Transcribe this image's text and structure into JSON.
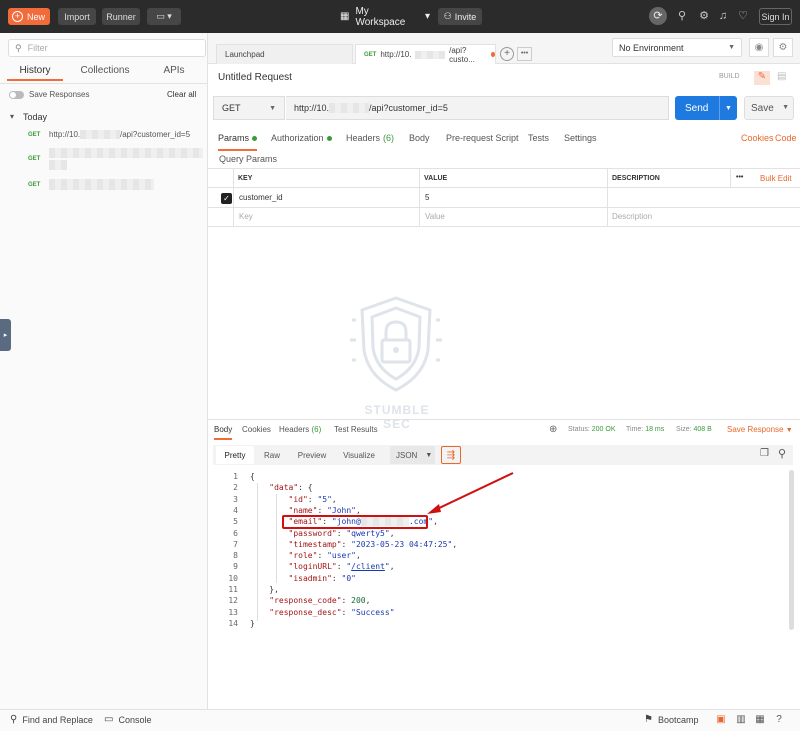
{
  "topbar": {
    "new_label": "New",
    "import_label": "Import",
    "runner_label": "Runner",
    "workspace": "My Workspace",
    "invite_label": "Invite",
    "signin_label": "Sign In"
  },
  "sidebar": {
    "filter_placeholder": "Filter",
    "tabs": [
      "History",
      "Collections",
      "APIs"
    ],
    "save_responses": "Save Responses",
    "clear_all": "Clear all",
    "group_label": "Today",
    "history_items": [
      {
        "method": "GET",
        "url_prefix": "http://10.",
        "url_suffix": "/api?customer_id=5"
      },
      {
        "method": "GET"
      },
      {
        "method": "GET"
      }
    ]
  },
  "tabs": {
    "launchpad": "Launchpad",
    "active_method": "GET",
    "active_label": "http://10.",
    "active_suffix": "/api?custo...",
    "environment": "No Environment"
  },
  "request": {
    "title": "Untitled Request",
    "build": "BUILD",
    "method": "GET",
    "url_prefix": "http://10.",
    "url_suffix": "/api?customer_id=5",
    "send_label": "Send",
    "save_label": "Save",
    "tabs": [
      "Params",
      "Authorization",
      "Headers",
      "(6)",
      "Body",
      "Pre-request Script",
      "Tests",
      "Settings"
    ],
    "cookies": "Cookies",
    "code": "Code",
    "query_params_title": "Query Params",
    "columns": {
      "key": "KEY",
      "value": "VALUE",
      "description": "DESCRIPTION",
      "more": "•••",
      "bulk_edit": "Bulk Edit"
    },
    "params": [
      {
        "key": "customer_id",
        "value": "5"
      }
    ],
    "placeholders": {
      "key": "Key",
      "value": "Value",
      "description": "Description"
    }
  },
  "watermark": {
    "text": "STUMBLE SEC"
  },
  "response": {
    "tabs": [
      "Body",
      "Cookies",
      "Headers",
      "(6)",
      "Test Results"
    ],
    "status_label": "Status:",
    "status_value": "200 OK",
    "time_label": "Time:",
    "time_value": "18 ms",
    "size_label": "Size:",
    "size_value": "408 B",
    "save_response": "Save Response",
    "views": [
      "Pretty",
      "Raw",
      "Preview",
      "Visualize"
    ],
    "format": "JSON",
    "lines": [
      {
        "n": "1",
        "parts": [
          [
            "p",
            "{"
          ]
        ]
      },
      {
        "n": "2",
        "parts": [
          [
            "p",
            "    "
          ],
          [
            "k",
            "\"data\""
          ],
          [
            "p",
            ": {"
          ]
        ]
      },
      {
        "n": "3",
        "parts": [
          [
            "p",
            "        "
          ],
          [
            "k",
            "\"id\""
          ],
          [
            "p",
            ": "
          ],
          [
            "s",
            "\"5\""
          ],
          [
            "p",
            ","
          ]
        ]
      },
      {
        "n": "4",
        "parts": [
          [
            "p",
            "        "
          ],
          [
            "k",
            "\"name\""
          ],
          [
            "p",
            ": "
          ],
          [
            "s",
            "\"John\""
          ],
          [
            "p",
            ","
          ]
        ]
      },
      {
        "n": "5",
        "parts": [
          [
            "p",
            "        "
          ],
          [
            "k",
            "\"email\""
          ],
          [
            "p",
            ": "
          ],
          [
            "s",
            "\"john@"
          ],
          [
            "b",
            "          "
          ],
          [
            "s",
            ".com\""
          ],
          [
            "p",
            ","
          ]
        ]
      },
      {
        "n": "6",
        "parts": [
          [
            "p",
            "        "
          ],
          [
            "k",
            "\"password\""
          ],
          [
            "p",
            ": "
          ],
          [
            "s",
            "\"qwerty5\""
          ],
          [
            "p",
            ","
          ]
        ]
      },
      {
        "n": "7",
        "parts": [
          [
            "p",
            "        "
          ],
          [
            "k",
            "\"timestamp\""
          ],
          [
            "p",
            ": "
          ],
          [
            "s",
            "\"2023-05-23 04:47:25\""
          ],
          [
            "p",
            ","
          ]
        ]
      },
      {
        "n": "8",
        "parts": [
          [
            "p",
            "        "
          ],
          [
            "k",
            "\"role\""
          ],
          [
            "p",
            ": "
          ],
          [
            "s",
            "\"user\""
          ],
          [
            "p",
            ","
          ]
        ]
      },
      {
        "n": "9",
        "parts": [
          [
            "p",
            "        "
          ],
          [
            "k",
            "\"loginURL\""
          ],
          [
            "p",
            ": "
          ],
          [
            "s",
            "\""
          ],
          [
            "u",
            "/client"
          ],
          [
            "s",
            "\""
          ],
          [
            "p",
            ","
          ]
        ]
      },
      {
        "n": "10",
        "parts": [
          [
            "p",
            "        "
          ],
          [
            "k",
            "\"isadmin\""
          ],
          [
            "p",
            ": "
          ],
          [
            "s",
            "\"0\""
          ]
        ]
      },
      {
        "n": "11",
        "parts": [
          [
            "p",
            "    },"
          ]
        ]
      },
      {
        "n": "12",
        "parts": [
          [
            "p",
            "    "
          ],
          [
            "k",
            "\"response_code\""
          ],
          [
            "p",
            ": "
          ],
          [
            "n",
            "200"
          ],
          [
            "p",
            ","
          ]
        ]
      },
      {
        "n": "13",
        "parts": [
          [
            "p",
            "    "
          ],
          [
            "k",
            "\"response_desc\""
          ],
          [
            "p",
            ": "
          ],
          [
            "s",
            "\"Success\""
          ]
        ]
      },
      {
        "n": "14",
        "parts": [
          [
            "p",
            "}"
          ]
        ]
      }
    ]
  },
  "footer": {
    "find_replace": "Find and Replace",
    "console": "Console",
    "bootcamp": "Bootcamp"
  },
  "colors": {
    "accent": "#f26b3a",
    "send": "#1f7ae0",
    "annotation": "#d01010"
  }
}
